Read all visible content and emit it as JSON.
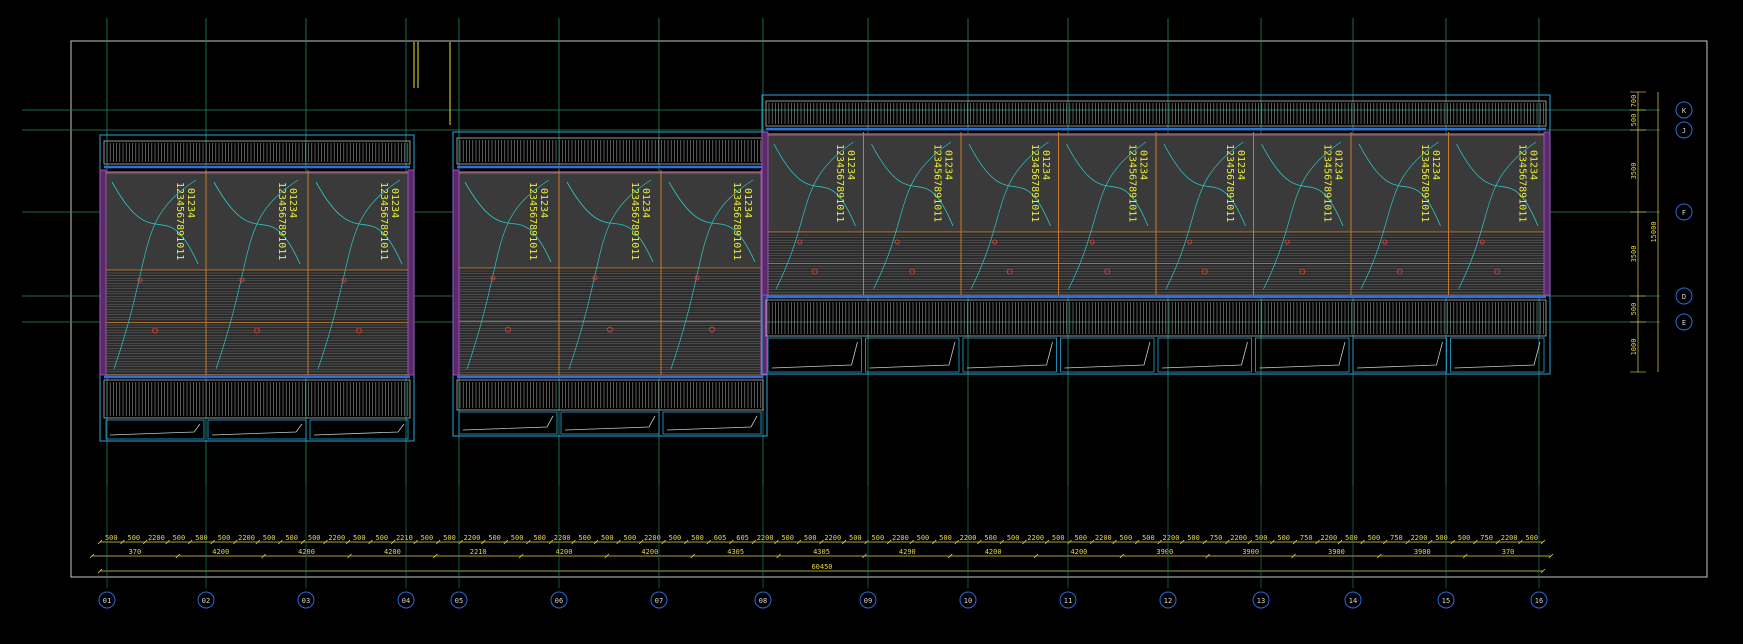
{
  "grid_columns": [
    "01",
    "02",
    "03",
    "04",
    "05",
    "06",
    "07",
    "08",
    "09",
    "10",
    "11",
    "12",
    "13",
    "14",
    "15",
    "16"
  ],
  "grid_rows": [
    "K",
    "J",
    "F",
    "D",
    "E"
  ],
  "dim_row_top": [
    "500",
    "500",
    "2200",
    "500",
    "500",
    "500",
    "2200",
    "500",
    "500",
    "500",
    "2200",
    "500",
    "500",
    "2210",
    "500",
    "500",
    "2200",
    "500",
    "500",
    "500",
    "2200",
    "500",
    "500",
    "500",
    "2200",
    "500",
    "500",
    "605",
    "605",
    "2200",
    "500",
    "500",
    "2200",
    "500",
    "500",
    "2200",
    "500",
    "500",
    "2200",
    "500",
    "500",
    "2200",
    "500",
    "500",
    "2200",
    "500",
    "500",
    "2200",
    "500",
    "750",
    "2200",
    "500",
    "500",
    "750",
    "2200",
    "500",
    "500",
    "750",
    "2200",
    "500",
    "500",
    "750",
    "2200",
    "500"
  ],
  "dim_row_mid": [
    "370",
    "4200",
    "4200",
    "4200",
    "2210",
    "4200",
    "4200",
    "4305",
    "4305",
    "4290",
    "4200",
    "4200",
    "3900",
    "3900",
    "3900",
    "3900",
    "370"
  ],
  "dim_total": "60450",
  "dim_vertical": [
    "700",
    "500",
    "3500",
    "3500",
    "500",
    "1000"
  ],
  "dim_vertical_total": "15000",
  "room_tags": [
    "1234567891011",
    "01234"
  ]
}
